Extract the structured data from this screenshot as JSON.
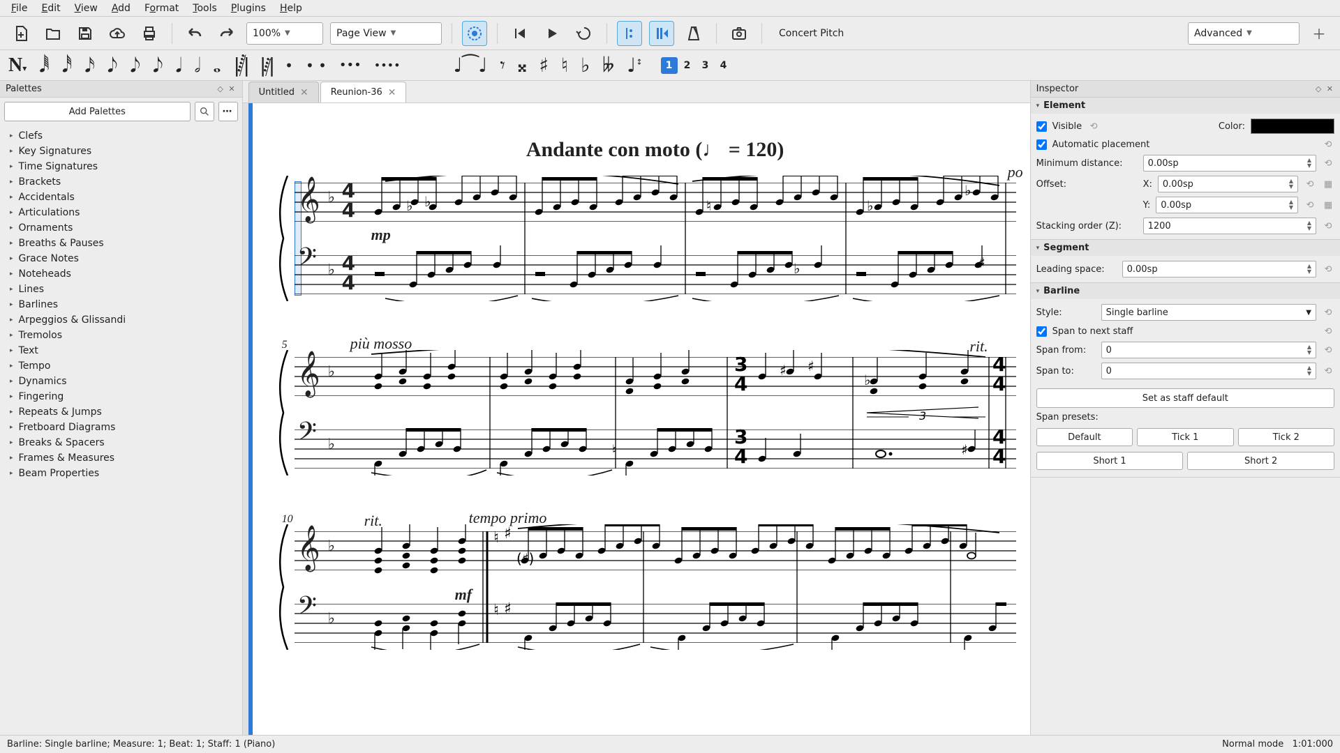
{
  "menu": [
    "File",
    "Edit",
    "View",
    "Add",
    "Format",
    "Tools",
    "Plugins",
    "Help"
  ],
  "toolbar": {
    "zoom": "100%",
    "viewmode": "Page View",
    "concert_pitch": "Concert Pitch",
    "workspace": "Advanced"
  },
  "voices": [
    "1",
    "2",
    "3",
    "4"
  ],
  "palettes": {
    "title": "Palettes",
    "add_label": "Add Palettes",
    "items": [
      "Clefs",
      "Key Signatures",
      "Time Signatures",
      "Brackets",
      "Accidentals",
      "Articulations",
      "Ornaments",
      "Breaths & Pauses",
      "Grace Notes",
      "Noteheads",
      "Lines",
      "Barlines",
      "Arpeggios & Glissandi",
      "Tremolos",
      "Text",
      "Tempo",
      "Dynamics",
      "Fingering",
      "Repeats & Jumps",
      "Fretboard Diagrams",
      "Breaks & Spacers",
      "Frames & Measures",
      "Beam Properties"
    ]
  },
  "tabs": [
    {
      "label": "Untitled",
      "active": false
    },
    {
      "label": "Reunion-36",
      "active": true
    }
  ],
  "score": {
    "tempo_title": "Andante con moto (♩ = 120)",
    "sys1": {
      "dyn": "mp",
      "measnum": "",
      "rightmark": "po"
    },
    "sys2": {
      "expr": "più mosso",
      "rit": "rit.",
      "measnum": "5",
      "triplet": "3"
    },
    "sys3": {
      "expr": "tempo primo",
      "rit": "rit.",
      "measnum": "10",
      "dyn": "mf"
    },
    "timesig_top": "4",
    "timesig_bot": "4",
    "timesig2_top": "3",
    "timesig2_bot": "4"
  },
  "inspector": {
    "title": "Inspector",
    "element": {
      "head": "Element",
      "visible": "Visible",
      "auto": "Automatic placement",
      "mindist_label": "Minimum distance:",
      "mindist": "0.00sp",
      "offset_label": "Offset:",
      "x_label": "X:",
      "x": "0.00sp",
      "y_label": "Y:",
      "y": "0.00sp",
      "stack_label": "Stacking order (Z):",
      "stack": "1200",
      "color_label": "Color:"
    },
    "segment": {
      "head": "Segment",
      "leading_label": "Leading space:",
      "leading": "0.00sp"
    },
    "barline": {
      "head": "Barline",
      "style_label": "Style:",
      "style": "Single barline",
      "span_next": "Span to next staff",
      "span_from_label": "Span from:",
      "span_from": "0",
      "span_to_label": "Span to:",
      "span_to": "0",
      "set_default": "Set as staff default",
      "presets_label": "Span presets:",
      "presets": [
        "Default",
        "Tick 1",
        "Tick 2",
        "Short 1",
        "Short 2"
      ]
    }
  },
  "status": {
    "left": "Barline: Single barline;  Measure: 1; Beat: 1; Staff: 1 (Piano)",
    "mode": "Normal mode",
    "pos": "1:01:000"
  }
}
